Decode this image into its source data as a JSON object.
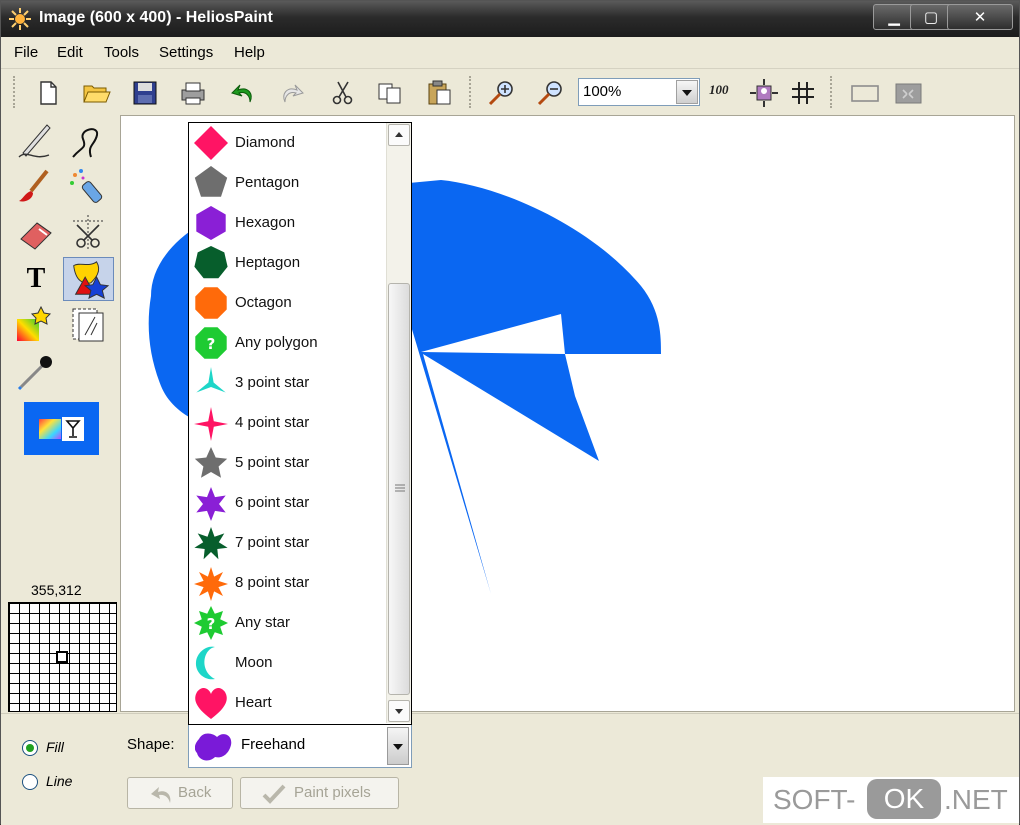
{
  "window": {
    "title": "Image (600 x 400) - HeliosPaint",
    "min_label": "▁",
    "max_label": "▢",
    "close_label": "✕"
  },
  "menu": {
    "items": [
      "File",
      "Edit",
      "Tools",
      "Settings",
      "Help"
    ]
  },
  "toolbar": {
    "zoom": "100%",
    "icons": [
      "new-file-icon",
      "open-folder-icon",
      "save-icon",
      "print-icon",
      "undo-icon",
      "redo-icon",
      "cut-icon",
      "copy-icon",
      "paste-icon",
      "zoom-in-icon",
      "zoom-out-icon",
      "zoom-100-icon",
      "fit-icon",
      "grid-icon",
      "select-rect-icon",
      "crop-icon"
    ],
    "zoom_100_label": "100"
  },
  "tools": {
    "selected": "shape-tool",
    "text_tool_label": "T"
  },
  "status": {
    "coordinates": "355,312"
  },
  "options": {
    "fill_label": "Fill",
    "line_label": "Line",
    "fill_selected": true,
    "shape_label": "Shape:",
    "shape_value": "Freehand",
    "back_label": "Back",
    "paint_pixels_label": "Paint pixels"
  },
  "shapes": [
    {
      "label": "Diamond",
      "color": "#ff1464"
    },
    {
      "label": "Pentagon",
      "color": "#6e6e6e"
    },
    {
      "label": "Hexagon",
      "color": "#8a1fd6"
    },
    {
      "label": "Heptagon",
      "color": "#075e2c"
    },
    {
      "label": "Octagon",
      "color": "#ff6a0a"
    },
    {
      "label": "Any polygon",
      "color": "#1ecb32"
    },
    {
      "label": "3 point star",
      "color": "#1ed6c8"
    },
    {
      "label": "4 point star",
      "color": "#ff1464"
    },
    {
      "label": "5 point star",
      "color": "#6e6e6e"
    },
    {
      "label": "6 point star",
      "color": "#8a1fd6"
    },
    {
      "label": "7 point star",
      "color": "#075e2c"
    },
    {
      "label": "8 point star",
      "color": "#ff6a0a"
    },
    {
      "label": "Any star",
      "color": "#1ecb32"
    },
    {
      "label": "Moon",
      "color": "#1ed6c8"
    },
    {
      "label": "Heart",
      "color": "#ff1464"
    }
  ],
  "freehand_color": "#7a1ad8",
  "canvas": {
    "fill_color": "#0a67f2"
  },
  "watermark": {
    "left": "SOFT-",
    "mid": "OK",
    "right": ".NET"
  }
}
